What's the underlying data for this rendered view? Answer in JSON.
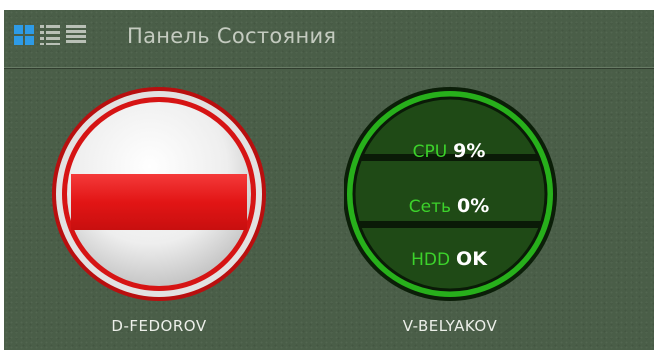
{
  "header": {
    "title": "Панель Состояния",
    "views": [
      {
        "icon": "grid-view-icon",
        "active": true,
        "color": "#2e9be6"
      },
      {
        "icon": "list-view-icon",
        "active": false,
        "color": "#b9c0b6"
      },
      {
        "icon": "detail-view-icon",
        "active": false,
        "color": "#b9c0b6"
      }
    ]
  },
  "devices": [
    {
      "name": "D-FEDOROV",
      "state": "offline",
      "icon": "no-entry-icon",
      "color": "#e01919"
    },
    {
      "name": "V-BELYAKOV",
      "state": "online",
      "color": "#27b01b",
      "metrics": [
        {
          "label": "CPU",
          "value": "9%"
        },
        {
          "label": "Сеть",
          "value": "0%"
        },
        {
          "label": "HDD",
          "value": "OK"
        }
      ]
    }
  ]
}
